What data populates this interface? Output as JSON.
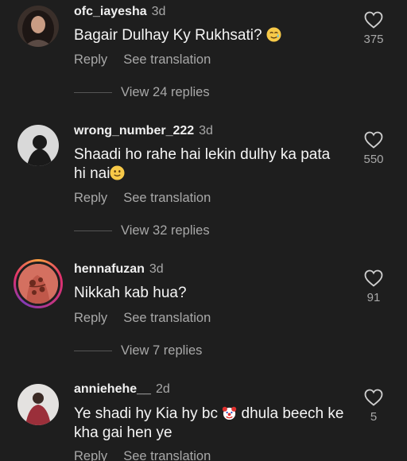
{
  "comments": [
    {
      "username": "ofc_iayesha",
      "time": "3d",
      "text": "Bagair Dulhay Ky Rukhsati?",
      "emoji": "smiling-tear-emoji",
      "likes": "375",
      "reply_label": "Reply",
      "translate_label": "See translation",
      "view_replies": "View 24 replies"
    },
    {
      "username": "wrong_number_222",
      "time": "3d",
      "text": "Shaadi ho rahe hai lekin dulhy ka pata hi nai",
      "emoji": "slight-smile-emoji",
      "likes": "550",
      "reply_label": "Reply",
      "translate_label": "See translation",
      "view_replies": "View 32 replies"
    },
    {
      "username": "hennafuzan",
      "time": "3d",
      "text": "Nikkah kab hua?",
      "likes": "91",
      "reply_label": "Reply",
      "translate_label": "See translation",
      "view_replies": "View 7 replies"
    },
    {
      "username": "anniehehe__",
      "time": "2d",
      "text_before": "Ye shadi hy Kia hy bc",
      "emoji": "clown-face-emoji",
      "text_after": "dhula beech ke kha gai hen ye",
      "likes": "5",
      "reply_label": "Reply",
      "translate_label": "See translation"
    }
  ]
}
